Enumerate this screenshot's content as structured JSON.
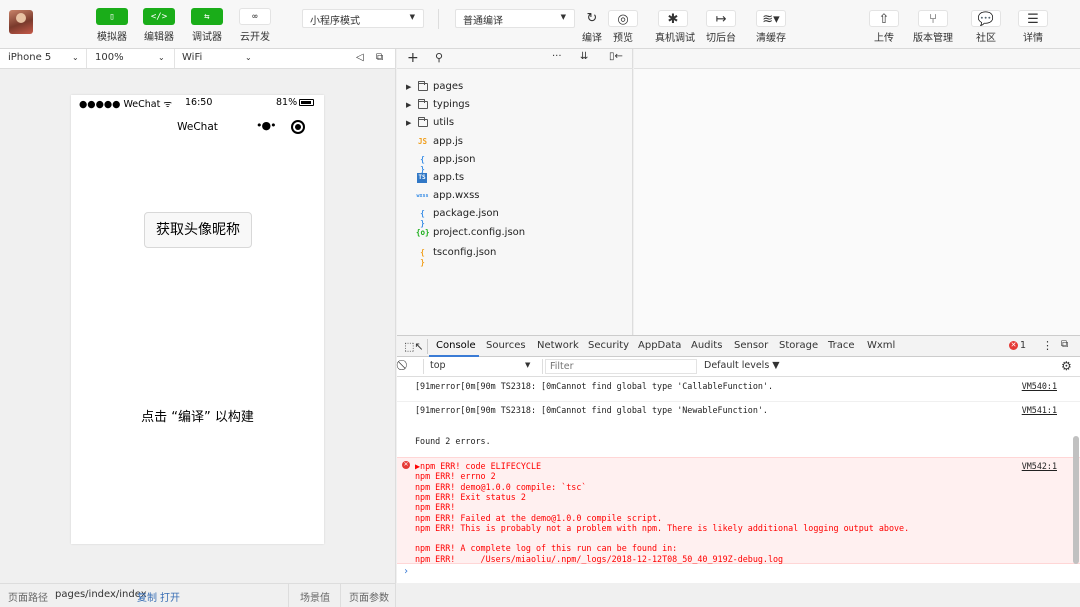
{
  "toolbar": {
    "simulator_label": "模拟器",
    "editor_label": "编辑器",
    "debugger_label": "调试器",
    "cloud_label": "云开发",
    "mode_select": "小程序模式",
    "compile_select": "普通编译",
    "compile_label": "编译",
    "preview_label": "预览",
    "remote_debug_label": "真机调试",
    "background_label": "切后台",
    "clear_cache_label": "清缓存",
    "upload_label": "上传",
    "version_label": "版本管理",
    "community_label": "社区",
    "details_label": "详情"
  },
  "simbar": {
    "device": "iPhone 5",
    "zoom": "100%",
    "network": "WiFi"
  },
  "phone": {
    "carrier": "●●●●● WeChat",
    "time": "16:50",
    "battery_text": "81%",
    "nav_title": "WeChat",
    "get_button": "获取头像昵称",
    "build_hint": "点击 “编译” 以构建"
  },
  "bottombar": {
    "path_label": "页面路径",
    "path_value": "pages/index/index",
    "copy": "复制",
    "open": "打开",
    "scene": "场景值",
    "params": "页面参数"
  },
  "explorer": {
    "folders": [
      "pages",
      "typings",
      "utils"
    ],
    "files": [
      {
        "name": "app.js",
        "icon": "JS",
        "color": "#f0a020"
      },
      {
        "name": "app.json",
        "icon": "{ }",
        "color": "#3a8ee6"
      },
      {
        "name": "app.ts",
        "icon": "TS",
        "color": "#3178c6"
      },
      {
        "name": "app.wxss",
        "icon": "wxss",
        "color": "#3a8ee6"
      },
      {
        "name": "package.json",
        "icon": "{ }",
        "color": "#3a8ee6"
      },
      {
        "name": "project.config.json",
        "icon": "{o}",
        "color": "#1aad19"
      },
      {
        "name": "tsconfig.json",
        "icon": "{ }",
        "color": "#f0a020"
      }
    ]
  },
  "devtools": {
    "tabs": [
      "Console",
      "Sources",
      "Network",
      "Security",
      "AppData",
      "Audits",
      "Sensor",
      "Storage",
      "Trace",
      "Wxml"
    ],
    "error_count": "1",
    "context": "top",
    "filter_placeholder": "Filter",
    "levels": "Default levels ▼"
  },
  "console": {
    "line1": "[91merror[0m[90m TS2318: [0mCannot find global type 'CallableFunction'.",
    "line1_src": "VM540:1",
    "line2": "[91merror[0m[90m TS2318: [0mCannot find global type 'NewableFunction'.",
    "line2_src": "VM541:1",
    "line3": "Found 2 errors.",
    "err_src": "VM542:1",
    "err_lines": [
      "▶npm ERR! code ELIFECYCLE",
      "npm ERR! errno 2",
      "npm ERR! demo@1.0.0 compile: `tsc`",
      "npm ERR! Exit status 2",
      "npm ERR!",
      "npm ERR! Failed at the demo@1.0.0 compile script.",
      "npm ERR! This is probably not a problem with npm. There is likely additional logging output above.",
      "",
      "npm ERR! A complete log of this run can be found in:",
      "npm ERR!     /Users/miaoliu/.npm/_logs/2018-12-12T08_50_40_919Z-debug.log"
    ],
    "prompt": "›"
  }
}
